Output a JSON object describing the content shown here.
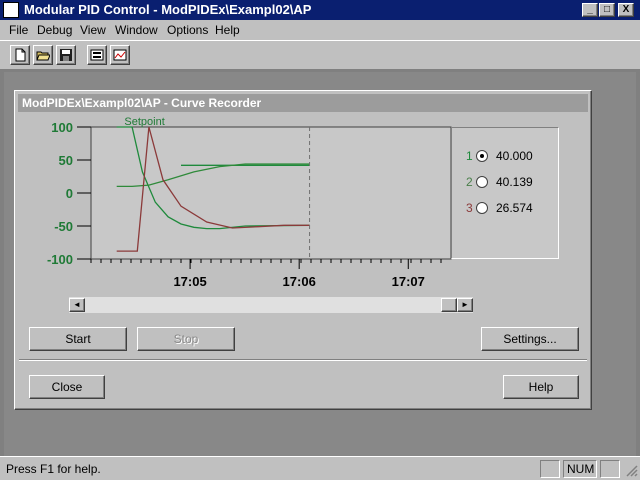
{
  "window": {
    "title": "Modular PID Control - ModPIDEx\\Exampl02\\AP"
  },
  "window_controls": {
    "minimize": "_",
    "maximize": "□",
    "close": "X"
  },
  "menu": [
    "File",
    "Debug",
    "View",
    "Window",
    "Options",
    "Help"
  ],
  "toolbar": {
    "icons": [
      "new-document-icon",
      "open-folder-icon",
      "save-disk-icon",
      "panel-view-icon",
      "chart-view-icon"
    ]
  },
  "child": {
    "title": "ModPIDEx\\Exampl02\\AP - Curve Recorder"
  },
  "chart_data": {
    "type": "line",
    "ylim": [
      -100,
      100
    ],
    "y_ticks": [
      "100",
      "50",
      "0",
      "-50",
      "-100"
    ],
    "x_ticks": [
      "17:05",
      "17:06",
      "17:07"
    ],
    "annotation": "Setpoint",
    "series": [
      {
        "color": "#1f8a3c",
        "x": [
          0,
          0.12,
          0.2,
          0.3,
          0.4,
          0.5,
          0.6,
          0.7,
          0.8,
          1.0,
          1.5
        ],
        "y": [
          100,
          100,
          32,
          -14,
          -36,
          -47,
          -52,
          -54,
          -54,
          -50,
          -49
        ]
      },
      {
        "color": "#1f8a3c",
        "x": [
          0.5,
          1.5
        ],
        "y": [
          42,
          42
        ]
      },
      {
        "color": "#2f8a3a",
        "x": [
          0,
          0.12,
          0.25,
          0.4,
          0.6,
          0.8,
          1.0,
          1.5
        ],
        "y": [
          10,
          10,
          12,
          20,
          32,
          40,
          44,
          44
        ]
      },
      {
        "color": "#8b3a3a",
        "x": [
          0,
          0.16,
          0.25,
          0.36,
          0.5,
          0.7,
          0.9,
          1.1,
          1.3,
          1.5
        ],
        "y": [
          -88,
          -88,
          100,
          20,
          -20,
          -44,
          -53,
          -51,
          -49,
          -49
        ]
      }
    ],
    "cursor_x": 1.5,
    "x_range": [
      -0.2,
      2.6
    ]
  },
  "legend": [
    {
      "num": "1",
      "value": "40.000",
      "color": "#1f8a3c",
      "checked": true
    },
    {
      "num": "2",
      "value": "40.139",
      "color": "#4a7f4a",
      "checked": false
    },
    {
      "num": "3",
      "value": "26.574",
      "color": "#8b3a3a",
      "checked": false
    }
  ],
  "buttons": {
    "start": "Start",
    "stop": "Stop",
    "settings": "Settings...",
    "close": "Close",
    "help": "Help"
  },
  "scroll": {
    "left": "◄",
    "right": "►"
  },
  "statusbar": {
    "text": "Press F1 for help.",
    "num": "NUM"
  }
}
